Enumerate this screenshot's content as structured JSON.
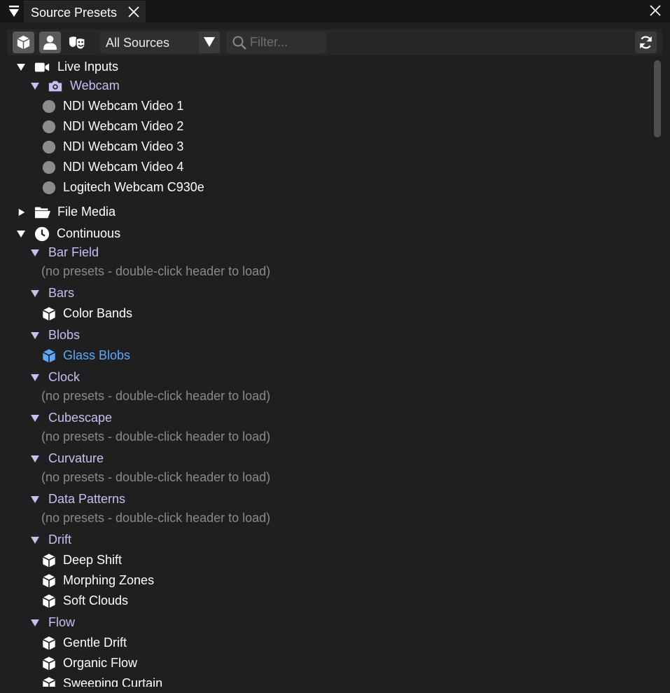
{
  "window": {
    "tab_title": "Source Presets"
  },
  "toolbar": {
    "source_filter_value": "All Sources",
    "filter_placeholder": "Filter..."
  },
  "tree": {
    "live_inputs": {
      "label": "Live Inputs",
      "webcam": {
        "label": "Webcam",
        "items": [
          "NDI Webcam Video 1",
          "NDI Webcam Video 2",
          "NDI Webcam Video 3",
          "NDI Webcam Video 4",
          "Logitech Webcam C930e"
        ]
      }
    },
    "file_media": {
      "label": "File Media"
    },
    "continuous": {
      "label": "Continuous",
      "empty_text": "(no presets - double-click header to load)",
      "groups": [
        {
          "label": "Bar Field",
          "presets": []
        },
        {
          "label": "Bars",
          "presets": [
            "Color Bands"
          ]
        },
        {
          "label": "Blobs",
          "presets": [
            "Glass Blobs"
          ],
          "selected": "Glass Blobs"
        },
        {
          "label": "Clock",
          "presets": []
        },
        {
          "label": "Cubescape",
          "presets": []
        },
        {
          "label": "Curvature",
          "presets": []
        },
        {
          "label": "Data Patterns",
          "presets": []
        },
        {
          "label": "Drift",
          "presets": [
            "Deep Shift",
            "Morphing Zones",
            "Soft Clouds"
          ]
        },
        {
          "label": "Flow",
          "presets": [
            "Gentle Drift",
            "Organic Flow",
            "Sweeping Curtain"
          ]
        }
      ]
    }
  },
  "colors": {
    "background": "#1f1f1f",
    "group_text": "#c3c0f2",
    "selected_text": "#5aa9ff",
    "muted_text": "#8a8a8a"
  },
  "icons": {
    "webcam_item": "circle-icon",
    "preset": "cube-icon",
    "live_inputs": "video-camera-icon",
    "webcam": "camera-icon",
    "file_media": "folder-open-icon",
    "continuous": "clock-icon"
  }
}
